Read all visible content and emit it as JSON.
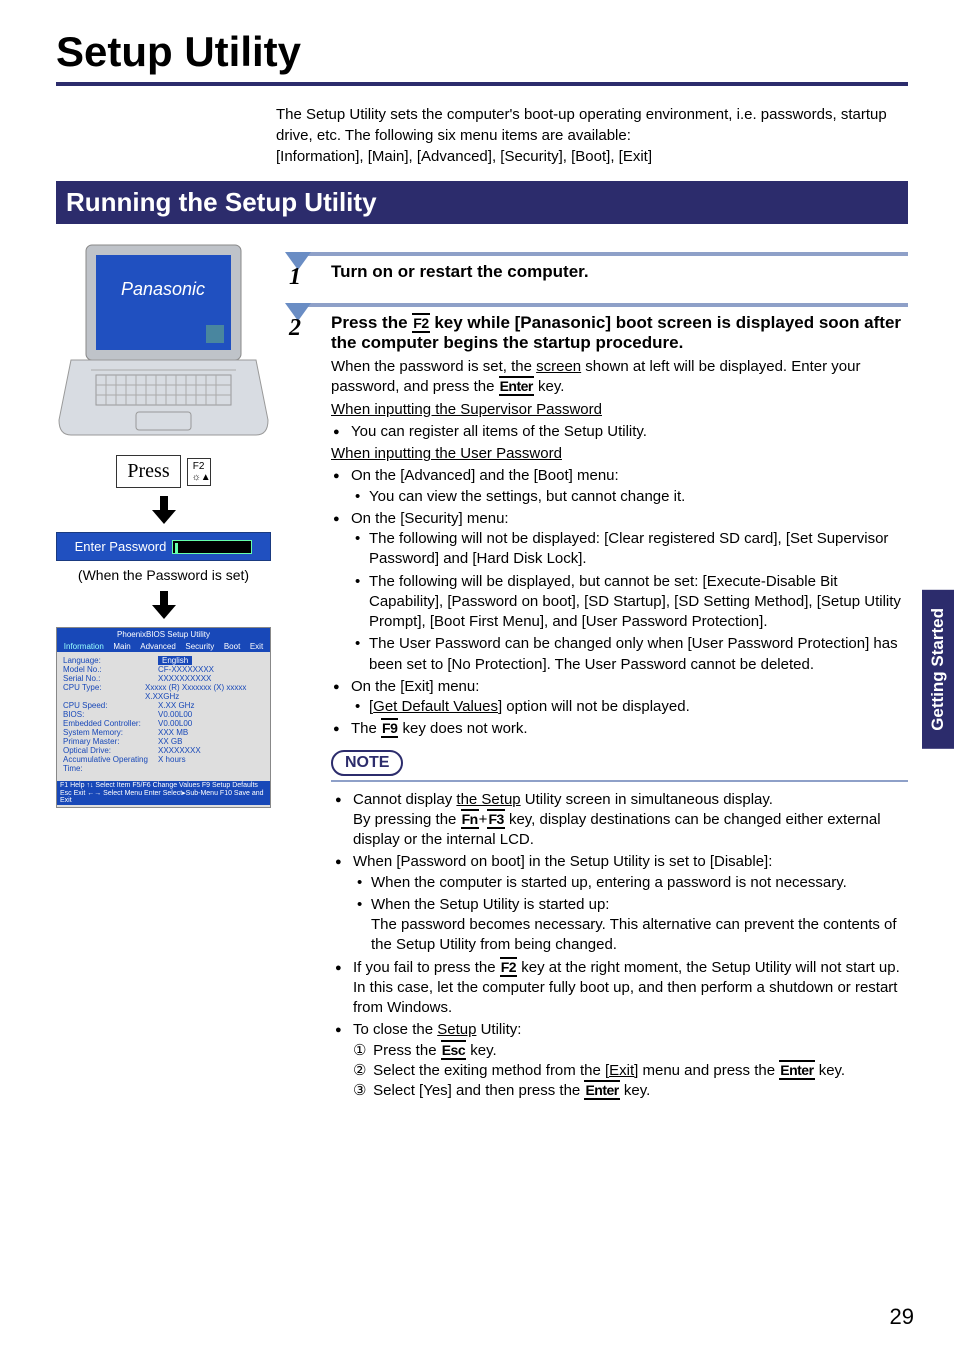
{
  "page_title": "Setup Utility",
  "intro": {
    "p1": "The Setup Utility sets the computer's boot-up operating environment, i.e. passwords, startup drive, etc. The following six menu items are available:",
    "p2": "[Information], [Main], [Advanced], [Security], [Boot], [Exit]"
  },
  "section_header": "Running the Setup Utility",
  "brand": "Panasonic",
  "press_label": "Press",
  "press_key_top": "F2",
  "press_key_bottom": "☼▲",
  "enter_banner": "Enter Password",
  "password_caption": "(When the Password is set)",
  "bios": {
    "title": "PhoenixBIOS Setup Utility",
    "tabs": [
      "Information",
      "Main",
      "Advanced",
      "Security",
      "Boot",
      "Exit"
    ],
    "rows": [
      {
        "label": "Language:",
        "val": "English",
        "highlight": true
      },
      {
        "label": "",
        "val": ""
      },
      {
        "label": "Model No.:",
        "val": "CF-XXXXXXXX"
      },
      {
        "label": "Serial No.:",
        "val": "XXXXXXXXXX"
      },
      {
        "label": "CPU Type:",
        "val": "Xxxxx (R) Xxxxxxx (X) xxxxx X.XXGHz"
      },
      {
        "label": "CPU Speed:",
        "val": "X.XX GHz"
      },
      {
        "label": "BIOS:",
        "val": "V0.00L00"
      },
      {
        "label": "Embedded Controller:",
        "val": "V0.00L00"
      },
      {
        "label": "System Memory:",
        "val": "XXX MB"
      },
      {
        "label": "Primary Master:",
        "val": "XX GB"
      },
      {
        "label": "Optical Drive:",
        "val": "XXXXXXXX"
      },
      {
        "label": "Accumulative Operating Time:",
        "val": "X hours"
      }
    ],
    "footer_left": "F1 Help  ↑↓ Select Item  F5/F6 Change Values  F9 Setup Defaults",
    "footer_right": "Esc Exit  ←→ Select Menu  Enter Select▸Sub-Menu  F10 Save and Exit"
  },
  "steps": {
    "s1": {
      "num": "1",
      "heading": "Turn on or restart the computer."
    },
    "s2": {
      "num": "2",
      "heading_a": "Press the ",
      "heading_key": "F2",
      "heading_b": " key while [Panasonic] boot screen is displayed soon after the computer begins the startup procedure.",
      "body1_a": "When the password is set, the ",
      "body1_link": "screen",
      "body1_b": " shown at left will be displayed. Enter your password, and press the ",
      "body1_key": "Enter",
      "body1_c": " key.",
      "sup_header": "When inputting the Supervisor Password",
      "sup_item": "You can register all items of the Setup Utility.",
      "user_header": "When inputting the User Password",
      "ua_label": "On the [Advanced] and the [Boot] menu:",
      "ua_item": "You can view the settings, but cannot change it.",
      "us_label": "On the [Security] menu:",
      "us_item1": "The following will not be displayed: [Clear registered SD card], [Set Supervisor Password] and [Hard Disk Lock].",
      "us_item2": "The following will be displayed, but cannot be set: [Execute-Disable Bit Capability], [Password on boot], [SD Startup], [SD Setting Method], [Setup Utility Prompt], [Boot First Menu], and [User Password Protection].",
      "us_item3": "The User Password can be changed only when [User Password Protection] has been set to [No Protection]. The User Password cannot be deleted.",
      "ue_label": "On the [Exit] menu:",
      "ue_item_a": "[",
      "ue_item_link": "Get Default Values",
      "ue_item_b": "] option will not be displayed.",
      "f9_a": "The ",
      "f9_key": "F9",
      "f9_b": " key does not work."
    }
  },
  "note_label": "NOTE",
  "notes": {
    "n1_a": "Cannot display ",
    "n1_link": "the Setup",
    "n1_b": " Utility screen in simultaneous display.",
    "n1_l2a": "By pressing the ",
    "n1_k1": "Fn",
    "n1_plus": "+",
    "n1_k2": "F3",
    "n1_l2b": " key, display destinations can be changed either external display or the internal LCD.",
    "n2": "When [Password on boot] in the Setup Utility is set to [Disable]:",
    "n2_s1": "When the computer is started up, entering a password is not necessary.",
    "n2_s2": "When the Setup Utility is started up:",
    "n2_s2b": "The password becomes necessary.  This alternative can prevent the contents of the Setup Utility from being changed.",
    "n3_a": "If you fail to press the ",
    "n3_key": "F2",
    "n3_b": " key at the right moment, the Setup Utility will not start up. In this case, let the computer fully boot up, and then perform a shutdown or restart from Windows.",
    "n4_a": "To close the ",
    "n4_link": "Setup",
    "n4_b": " Utility:",
    "n4_step1_a": "Press the ",
    "n4_step1_key": "Esc",
    "n4_step1_b": " key.",
    "n4_step2_a": "Select the exiting method from the ",
    "n4_step2_link": "[Exit]",
    "n4_step2_b": " menu and press the ",
    "n4_step2_key": "Enter",
    "n4_step2_c": " key.",
    "n4_step3_a": "Select [Yes] and then press the ",
    "n4_step3_key": "Enter",
    "n4_step3_b": " key.",
    "enum1": "①",
    "enum2": "②",
    "enum3": "③"
  },
  "side_tab": "Getting Started",
  "page_number": "29"
}
